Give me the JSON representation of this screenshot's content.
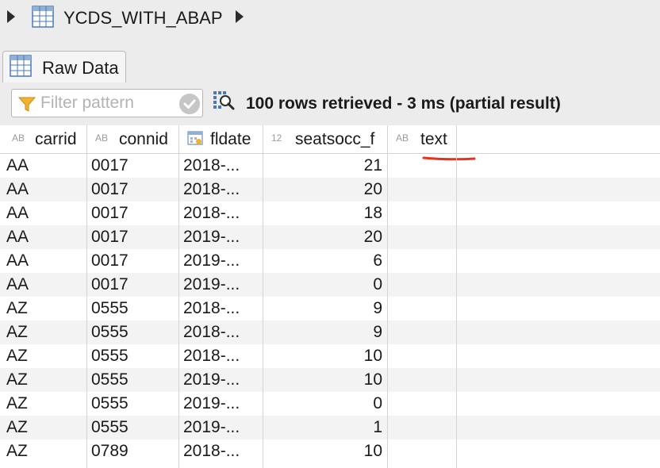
{
  "breadcrumb": {
    "table_name": "YCDS_WITH_ABAP",
    "icons": [
      "expand-arrow-icon",
      "table-icon",
      "next-arrow-icon"
    ]
  },
  "tab": {
    "label": "Raw Data",
    "icon": "table-icon"
  },
  "toolbar": {
    "filter_placeholder": "Filter pattern",
    "filter_value": "",
    "status": "100 rows retrieved - 3 ms (partial result)"
  },
  "columns": [
    {
      "type_tag": "AB",
      "label": "carrid"
    },
    {
      "type_tag": "AB",
      "label": "connid"
    },
    {
      "type_tag": "",
      "label": "fldate",
      "icon": "calendar-icon"
    },
    {
      "type_tag": "12",
      "label": "seatsocc_f"
    },
    {
      "type_tag": "AB",
      "label": "text"
    }
  ],
  "rows": [
    [
      "AA",
      "0017",
      "2018-...",
      "21",
      ""
    ],
    [
      "AA",
      "0017",
      "2018-...",
      "20",
      ""
    ],
    [
      "AA",
      "0017",
      "2018-...",
      "18",
      ""
    ],
    [
      "AA",
      "0017",
      "2019-...",
      "20",
      ""
    ],
    [
      "AA",
      "0017",
      "2019-...",
      "6",
      ""
    ],
    [
      "AA",
      "0017",
      "2019-...",
      "0",
      ""
    ],
    [
      "AZ",
      "0555",
      "2018-...",
      "9",
      ""
    ],
    [
      "AZ",
      "0555",
      "2018-...",
      "9",
      ""
    ],
    [
      "AZ",
      "0555",
      "2018-...",
      "10",
      ""
    ],
    [
      "AZ",
      "0555",
      "2019-...",
      "10",
      ""
    ],
    [
      "AZ",
      "0555",
      "2019-...",
      "0",
      ""
    ],
    [
      "AZ",
      "0555",
      "2019-...",
      "1",
      ""
    ],
    [
      "AZ",
      "0789",
      "2018-...",
      "10",
      ""
    ]
  ],
  "colors": {
    "annotation": "#e8321e",
    "row_alt": "#f3f3f3",
    "funnel": "#f2b230"
  }
}
